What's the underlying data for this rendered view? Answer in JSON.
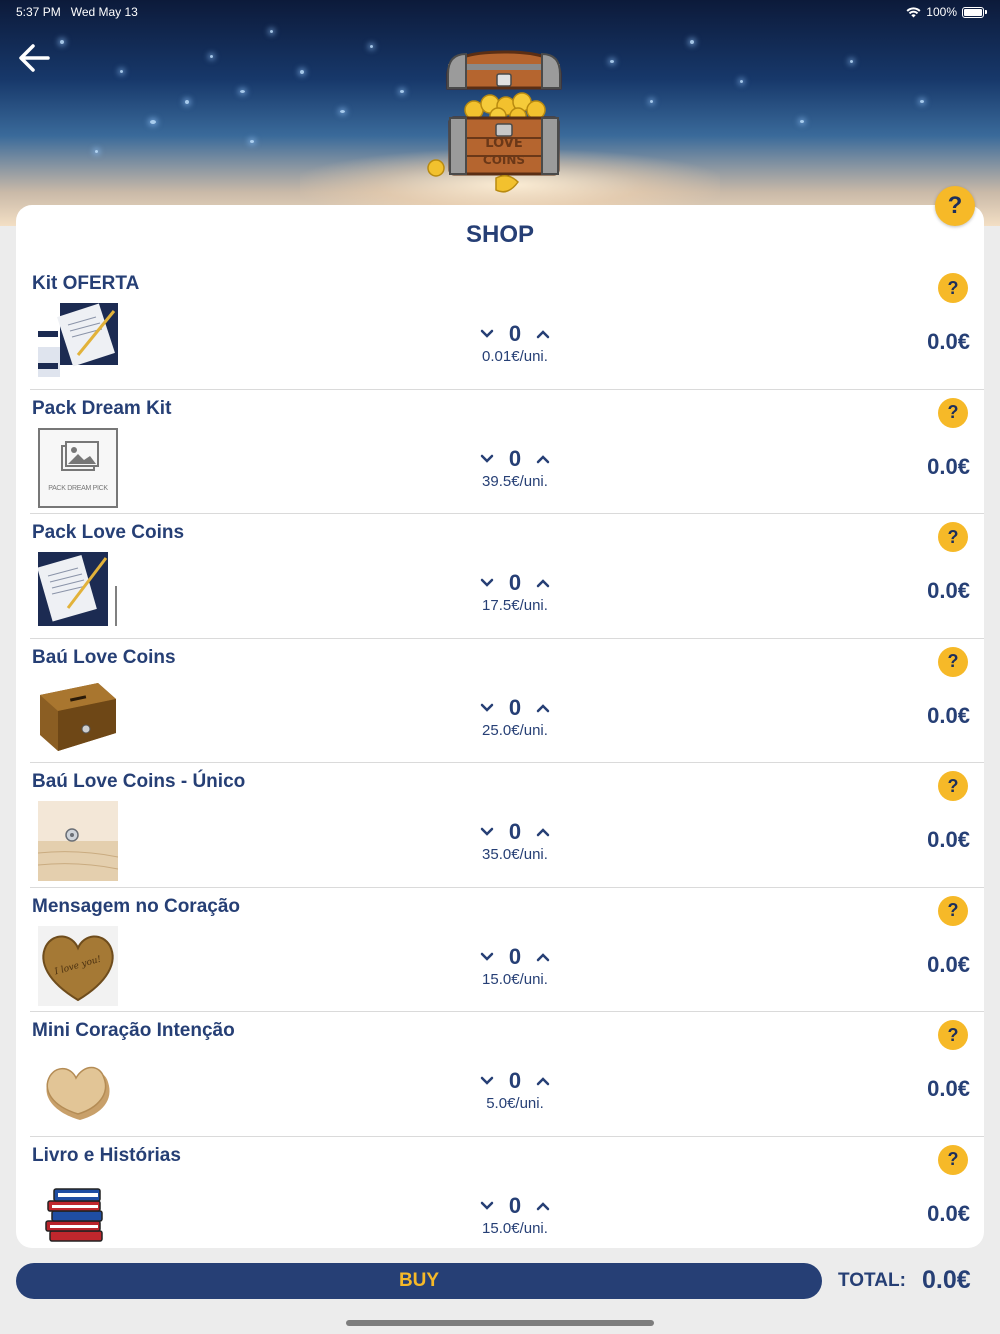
{
  "status_bar": {
    "time": "5:37 PM",
    "date": "Wed May 13",
    "battery": "100%",
    "battery_level": 1.0
  },
  "header": {
    "back_icon": "arrow-left-icon",
    "banner_image": "treasure-chest-love-coins",
    "chest_text_1": "LOVE",
    "chest_text_2": "COINS"
  },
  "shop": {
    "title": "SHOP",
    "help_icon": "question-icon",
    "items": [
      {
        "name": "Kit OFERTA",
        "quantity": "0",
        "unit_price": "0.01€/uni.",
        "total": "0.0€",
        "thumb": "letter-pen-image"
      },
      {
        "name": "Pack Dream Kit",
        "quantity": "0",
        "unit_price": "39.5€/uni.",
        "total": "0.0€",
        "thumb": "placeholder-image",
        "thumb_caption": "PACK DREAM PICK"
      },
      {
        "name": "Pack Love Coins",
        "quantity": "0",
        "unit_price": "17.5€/uni.",
        "total": "0.0€",
        "thumb": "letter-pen-image"
      },
      {
        "name": "Baú Love Coins",
        "quantity": "0",
        "unit_price": "25.0€/uni.",
        "total": "0.0€",
        "thumb": "wooden-box-image"
      },
      {
        "name": "Baú Love Coins - Único",
        "quantity": "0",
        "unit_price": "35.0€/uni.",
        "total": "0.0€",
        "thumb": "wood-surface-image"
      },
      {
        "name": "Mensagem no Coração",
        "quantity": "0",
        "unit_price": "15.0€/uni.",
        "total": "0.0€",
        "thumb": "wooden-heart-engraved-image",
        "thumb_engraving": "I love you!"
      },
      {
        "name": "Mini Coração Intenção",
        "quantity": "0",
        "unit_price": "5.0€/uni.",
        "total": "0.0€",
        "thumb": "mini-wooden-heart-image"
      },
      {
        "name": "Livro e Histórias",
        "quantity": "0",
        "unit_price": "15.0€/uni.",
        "total": "0.0€",
        "thumb": "books-stack-image"
      }
    ]
  },
  "footer": {
    "buy_label": "BUY",
    "total_label": "TOTAL:",
    "total_value": "0.0€"
  },
  "colors": {
    "navy": "#263f75",
    "accent_yellow": "#f6b928",
    "background": "#ececec"
  }
}
